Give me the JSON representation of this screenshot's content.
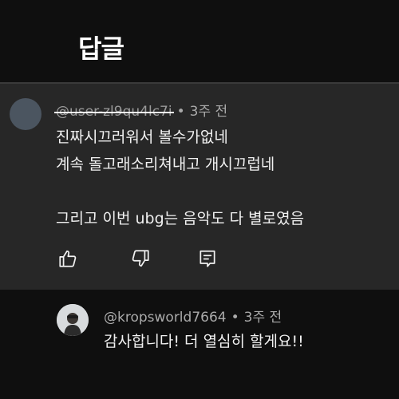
{
  "header": {
    "title": "답글"
  },
  "parent_comment": {
    "username": "@user-zl9qu4lc7i",
    "dot": "•",
    "time": "3주 전",
    "lines": [
      "진짜시끄러워서 볼수가없네",
      "계속 돌고래소리쳐내고 개시끄럽네",
      "",
      "그리고 이번 ubg는 음악도 다 별로였음"
    ],
    "actions": {
      "like": "thumb-up-icon",
      "dislike": "thumb-down-icon",
      "reply": "reply-icon"
    }
  },
  "reply": {
    "username": "@kropsworld7664",
    "dot": "•",
    "time": "3주 전",
    "text": "감사합니다! 더 열심히 할게요!!"
  },
  "colors": {
    "background": "#0f0f0f",
    "highlight_card": "#272727",
    "primary_text": "#f1f1f1",
    "secondary_text": "#aaaaaa"
  }
}
